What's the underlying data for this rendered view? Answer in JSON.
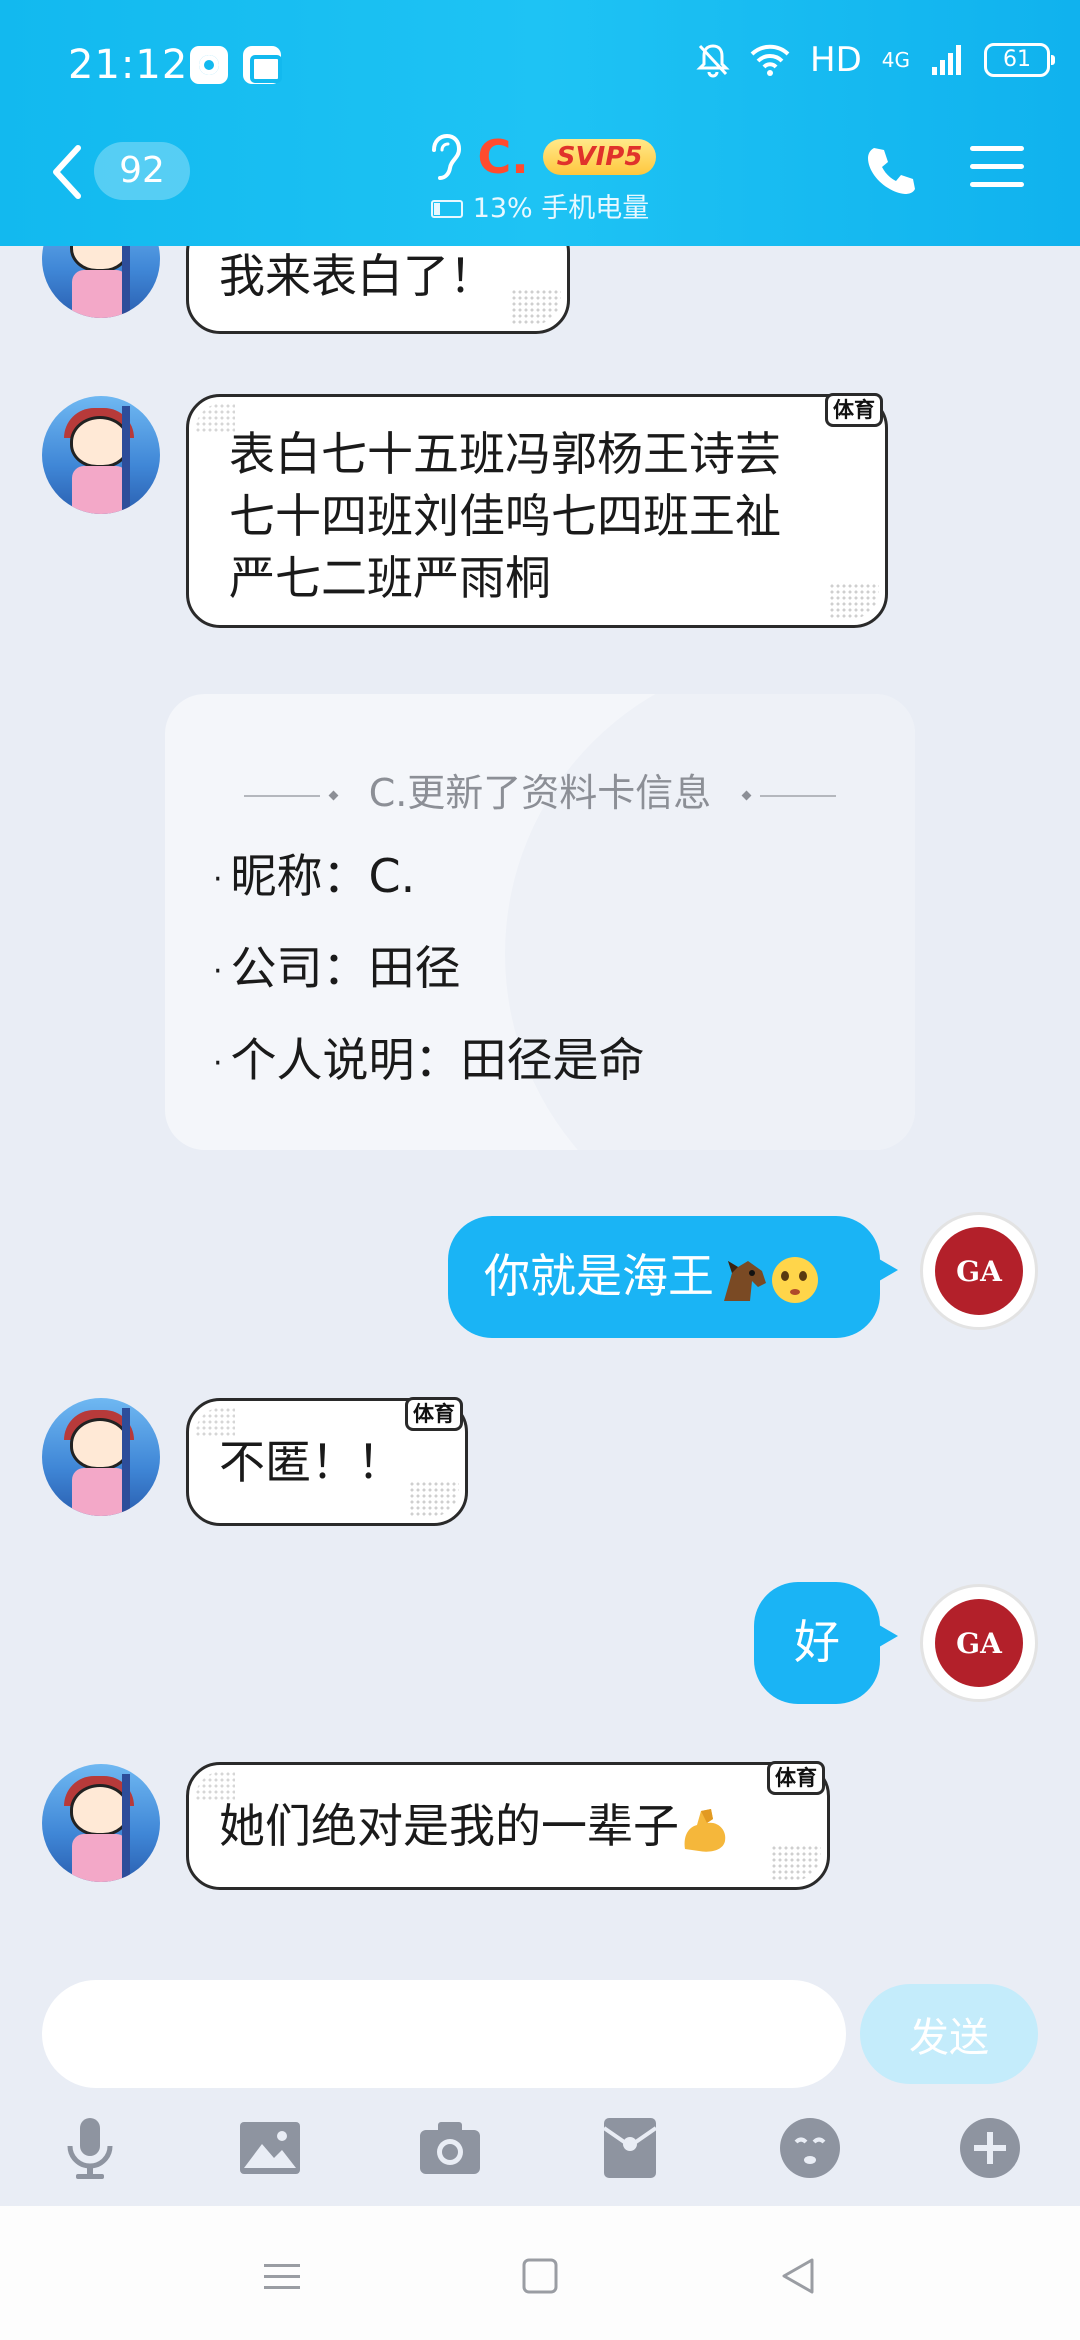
{
  "status_bar": {
    "time": "21:12",
    "hd_label": "HD",
    "network_label": "4G",
    "battery_level": "61"
  },
  "header": {
    "unread_count": "92",
    "contact_name": "C.",
    "vip_badge": "SVIP5",
    "subtitle": "13% 手机电量",
    "accent_color": "#12b9ef"
  },
  "messages": [
    {
      "side": "left",
      "text": "我来表白了！",
      "tag": ""
    },
    {
      "side": "left",
      "text": "表白七十五班冯郭杨王诗芸七十四班刘佳鸣七四班王祉严七二班严雨桐",
      "tag": "体育"
    },
    {
      "side": "right",
      "text": "你就是海王",
      "emoji": [
        "horse-emoji",
        "pleading-face-emoji"
      ]
    },
    {
      "side": "left",
      "text": "不匿！！",
      "tag": "体育"
    },
    {
      "side": "right",
      "text": "好"
    },
    {
      "side": "left",
      "text": "她们绝对是我的一辈子",
      "tag": "体育",
      "emoji": [
        "flexed-biceps-emoji"
      ]
    }
  ],
  "msg_lines": {
    "m2_l1": "表白七十五班冯郭杨王诗芸",
    "m2_l2": "七十四班刘佳鸣七四班王祉",
    "m2_l3": "严七二班严雨桐"
  },
  "profile_card": {
    "header": "C.更新了资料卡信息",
    "nickname_label": "昵称：",
    "nickname_value": "C.",
    "company_label": "公司：",
    "company_value": "田径",
    "bio_label": "个人说明：",
    "bio_value": "田径是命"
  },
  "input": {
    "placeholder": "",
    "value": "",
    "send_label": "发送"
  },
  "toolbar": [
    "microphone-icon",
    "image-icon",
    "camera-icon",
    "red-packet-icon",
    "emoji-icon",
    "plus-icon"
  ]
}
